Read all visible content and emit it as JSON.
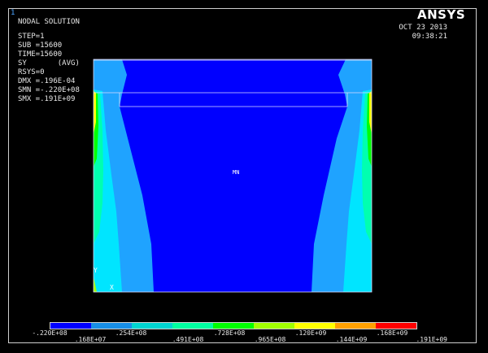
{
  "window_number": "1",
  "logo": "ANSYS",
  "date": "OCT 23 2013",
  "time": "09:38:21",
  "info_lines": [
    "NODAL SOLUTION",
    "",
    "STEP=1",
    "SUB =15600",
    "TIME=15600",
    "SY       (AVG)",
    "RSYS=0",
    "DMX =.196E-04",
    "SMN =-.220E+08",
    "SMX =.191E+09"
  ],
  "plot_labels": {
    "mn": "MN",
    "y_axis": "Y",
    "x_axis": "X"
  },
  "legend": {
    "colors": [
      "#0000ff",
      "#178ee6",
      "#00d4d0",
      "#00ffa0",
      "#00ff00",
      "#a0ff00",
      "#ffff00",
      "#ffa000",
      "#ff0000"
    ],
    "top_labels": [
      ".220E+08",
      ".254E+08",
      ".728E+08",
      ".120E+09",
      ".168E+09"
    ],
    "top_labels_prefix": "-",
    "bottom_labels": [
      ".168E+07",
      ".491E+08",
      ".965E+08",
      ".144E+09",
      ".191E+09"
    ]
  },
  "contour_colors": {
    "dark_blue": "#0000ff",
    "light_blue": "#1fa3ff",
    "cyan": "#00e5ff",
    "teal_green": "#00ffb0",
    "green": "#00ff00",
    "yellow": "#ffff00"
  }
}
